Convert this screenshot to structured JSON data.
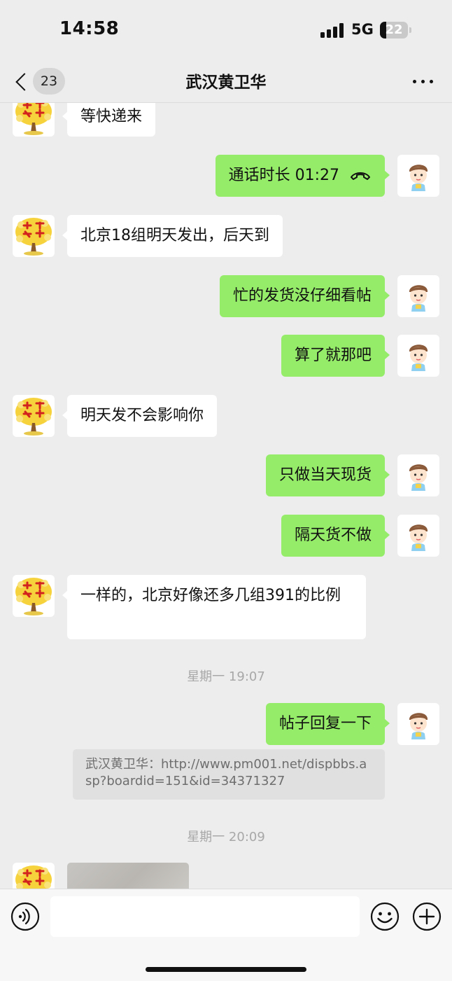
{
  "status_bar": {
    "time": "14:58",
    "network": "5G",
    "battery": "22",
    "battery_level": 0.22
  },
  "header": {
    "title": "武汉黄卫华",
    "unread_count": "23"
  },
  "messages": [
    {
      "dir": "in",
      "text": "等快递来"
    },
    {
      "dir": "out",
      "text": "通话时长 01:27",
      "icon": "phone-hangup-icon"
    },
    {
      "dir": "in",
      "text": "北京18组明天发出，后天到"
    },
    {
      "dir": "out",
      "text": "忙的发货没仔细看帖"
    },
    {
      "dir": "out",
      "text": "算了就那吧"
    },
    {
      "dir": "in",
      "text": "明天发不会影响你"
    },
    {
      "dir": "out",
      "text": "只做当天现货"
    },
    {
      "dir": "out",
      "text": "隔天货不做"
    },
    {
      "dir": "in",
      "text": "一样的，北京好像还多几组391的比例"
    },
    {
      "timestamp": "星期一 19:07"
    },
    {
      "dir": "out",
      "text": "帖子回复一下"
    },
    {
      "quote": "武汉黄卫华：http://www.pm001.net/dispbbs.asp?boardid=151&id=34371327"
    },
    {
      "timestamp": "星期一 20:09"
    }
  ],
  "input": {
    "value": ""
  },
  "colors": {
    "background": "#ededed",
    "bubble_out": "#95ec69",
    "bubble_in": "#ffffff",
    "timestamp": "#a8a8a8"
  }
}
